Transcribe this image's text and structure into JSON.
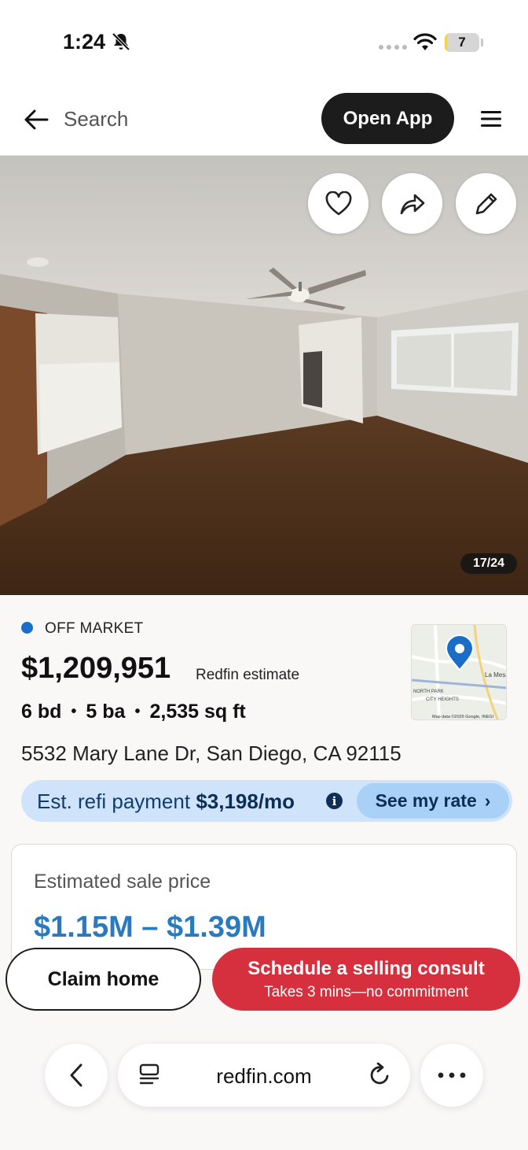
{
  "status_bar": {
    "time": "1:24",
    "battery": "7",
    "battery_level": 0.07
  },
  "header": {
    "search_label": "Search",
    "open_app_label": "Open App"
  },
  "photo": {
    "counter": "17/24"
  },
  "listing": {
    "status": "OFF MARKET",
    "status_color": "#1a6ec9",
    "price": "$1,209,951",
    "price_note": "Redfin estimate",
    "beds": "6 bd",
    "baths": "5 ba",
    "sqft": "2,535 sq ft",
    "separator": "•",
    "address": "5532 Mary Lane Dr, San Diego, CA 92115"
  },
  "map": {
    "label_1": "La Mesa",
    "label_2": "CITY HEIGHTS",
    "label_3": "NORTH PARK",
    "attribution": "Map data ©2026 Google, INEGI"
  },
  "refi": {
    "label": "Est. refi payment",
    "amount": "$3,198/mo",
    "info_glyph": "i",
    "button_label": "See my rate",
    "button_chevron": "›"
  },
  "estimate_card": {
    "label": "Estimated sale price",
    "range": "$1.15M – $1.39M"
  },
  "actions": {
    "claim_label": "Claim home",
    "consult_title": "Schedule a selling consult",
    "consult_subtitle": "Takes 3 mins—no commitment"
  },
  "browser": {
    "url": "redfin.com"
  },
  "colors": {
    "accent_red": "#d6303f",
    "accent_blue": "#2a7ac0",
    "pill_blue": "#cfe4fb"
  }
}
